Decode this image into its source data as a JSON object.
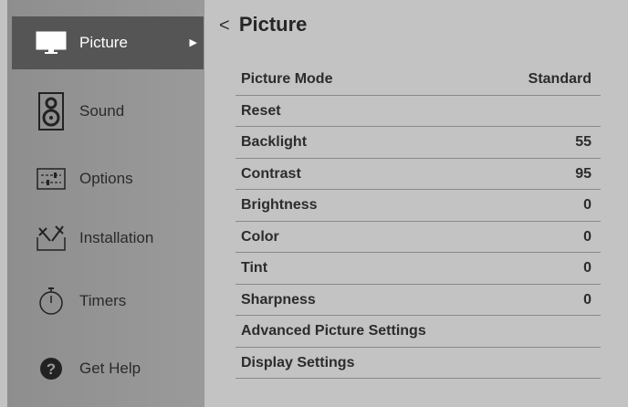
{
  "sidebar": {
    "items": [
      {
        "label": "Picture",
        "icon": "tv-icon",
        "active": true
      },
      {
        "label": "Sound",
        "icon": "speaker-icon"
      },
      {
        "label": "Options",
        "icon": "options-icon"
      },
      {
        "label": "Installation",
        "icon": "tools-icon"
      },
      {
        "label": "Timers",
        "icon": "timer-icon"
      },
      {
        "label": "Get Help",
        "icon": "help-icon"
      }
    ],
    "active_arrow": "▶"
  },
  "main": {
    "back_symbol": "<",
    "title": "Picture",
    "rows": [
      {
        "label": "Picture  Mode",
        "value": "Standard"
      },
      {
        "label": "Reset",
        "value": ""
      },
      {
        "label": "Backlight",
        "value": "55"
      },
      {
        "label": "Contrast",
        "value": "95"
      },
      {
        "label": "Brightness",
        "value": "0"
      },
      {
        "label": "Color",
        "value": "0"
      },
      {
        "label": "Tint",
        "value": "0"
      },
      {
        "label": "Sharpness",
        "value": "0"
      },
      {
        "label": "Advanced Picture Settings",
        "value": ""
      },
      {
        "label": "Display Settings",
        "value": ""
      }
    ]
  },
  "colors": {
    "background": "#c3c3c3",
    "sidebar": "#929292",
    "active_item": "#555555",
    "text": "#2c2c2c"
  }
}
